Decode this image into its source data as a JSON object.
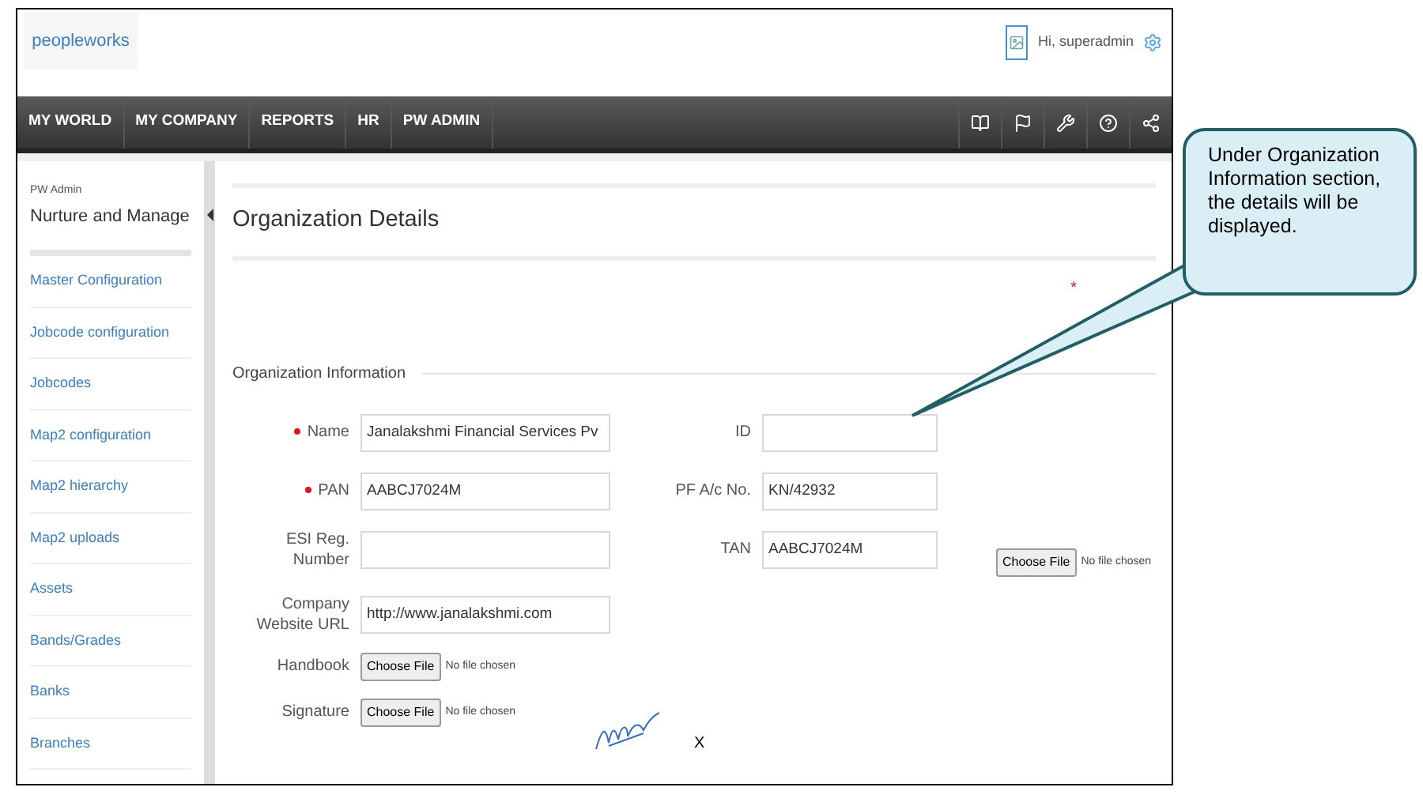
{
  "header": {
    "logo": "peopleworks",
    "greeting": "Hi, superadmin"
  },
  "nav": {
    "items": [
      "MY WORLD",
      "MY COMPANY",
      "REPORTS",
      "HR",
      "PW ADMIN"
    ]
  },
  "sidebar": {
    "caption": "PW Admin",
    "title": "Nurture and Manage",
    "items": [
      "Master Configuration",
      "Jobcode configuration",
      "Jobcodes",
      "Map2 configuration",
      "Map2 hierarchy",
      "Map2 uploads",
      "Assets",
      "Bands/Grades",
      "Banks",
      "Branches"
    ]
  },
  "page": {
    "title": "Organization Details",
    "required_mark": "*",
    "section": "Organization Information",
    "rows": [
      {
        "left": {
          "kind": "text",
          "label": "Name",
          "required": true,
          "value": "Janalakshmi Financial Services Pv"
        },
        "right": {
          "kind": "text",
          "label": "ID",
          "required": false
        }
      },
      {
        "left": {
          "kind": "text",
          "label": "PAN",
          "required": true,
          "value": "AABCJ7024M"
        },
        "right": {
          "kind": "text",
          "label": "PF A/c No.",
          "required": false,
          "value": "KN/42932"
        }
      },
      {
        "left": {
          "kind": "text",
          "label": "ESI Reg. Number",
          "required": false
        },
        "right": {
          "kind": "text",
          "label": "TAN",
          "required": false,
          "value": "AABCJ7024M"
        },
        "extra": {
          "kind": "file",
          "button": "Choose File",
          "status": "No file chosen"
        }
      },
      {
        "left": {
          "kind": "text",
          "label": "Company Website URL",
          "required": false,
          "value": "http://www.janalakshmi.com"
        }
      },
      {
        "left": {
          "kind": "file",
          "label": "Handbook",
          "required": false,
          "button": "Choose File",
          "status": "No file chosen"
        }
      },
      {
        "left": {
          "kind": "file",
          "label": "Signature",
          "required": false,
          "button": "Choose File",
          "status": "No file chosen"
        },
        "signature": {
          "remove": "X"
        }
      }
    ]
  },
  "callout": {
    "text": "Under Organization Information section, the details will be displayed."
  }
}
